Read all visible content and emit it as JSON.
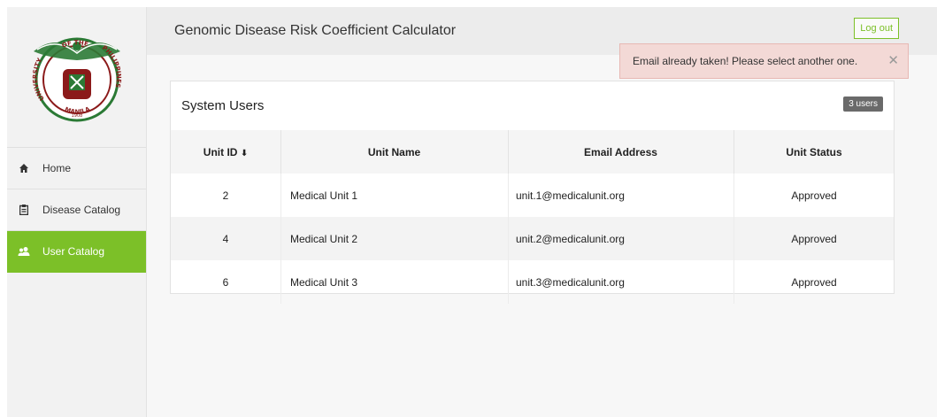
{
  "app": {
    "title": "Genomic Disease Risk Coefficient Calculator"
  },
  "header": {
    "logout_label": "Log out"
  },
  "logo": {
    "top_text": "OF THE",
    "left_text": "UNIVERSITY",
    "right_text": "PHILIPPINES",
    "bottom_text": "MANILA",
    "year": "1908"
  },
  "sidebar": {
    "items": [
      {
        "label": "Home",
        "icon": "home-icon",
        "active": false
      },
      {
        "label": "Disease Catalog",
        "icon": "clipboard-icon",
        "active": false
      },
      {
        "label": "User Catalog",
        "icon": "users-icon",
        "active": true
      }
    ]
  },
  "alert": {
    "message": "Email already taken! Please select another one.",
    "close": "✕"
  },
  "panel": {
    "title": "System Users",
    "badge": "3 users"
  },
  "table": {
    "headers": [
      "Unit ID",
      "Unit Name",
      "Email Address",
      "Unit Status"
    ],
    "sort_indicator": "🠗",
    "rows": [
      [
        "2",
        "Medical Unit 1",
        "unit.1@medicalunit.org",
        "Approved"
      ],
      [
        "4",
        "Medical Unit 2",
        "unit.2@medicalunit.org",
        "Approved"
      ],
      [
        "6",
        "Medical Unit 3",
        "unit.3@medicalunit.org",
        "Approved"
      ]
    ]
  },
  "colors": {
    "accent": "#7cc028",
    "alert_bg": "#f3d9d6",
    "badge": "#6a6a6a"
  }
}
